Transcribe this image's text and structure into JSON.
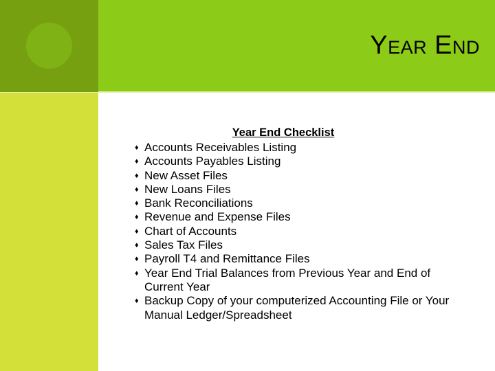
{
  "slide": {
    "title": "Year End",
    "colors": {
      "header_band": "#8ccb18",
      "header_block": "#76a010",
      "header_circle": "#7fb214",
      "left_column": "#d4e03a",
      "background": "#ffffff",
      "text": "#000000"
    }
  },
  "content": {
    "heading": "Year End Checklist",
    "bullet_glyph": "♦",
    "items": [
      "Accounts Receivables Listing",
      "Accounts Payables Listing",
      "New Asset Files",
      "New Loans Files",
      "Bank Reconciliations",
      "Revenue and Expense Files",
      "Chart of Accounts",
      "Sales Tax Files",
      "Payroll T4 and Remittance Files",
      "Year End Trial Balances from Previous Year and End of Current Year",
      "Backup Copy of your computerized Accounting File or Your Manual Ledger/Spreadsheet"
    ]
  }
}
